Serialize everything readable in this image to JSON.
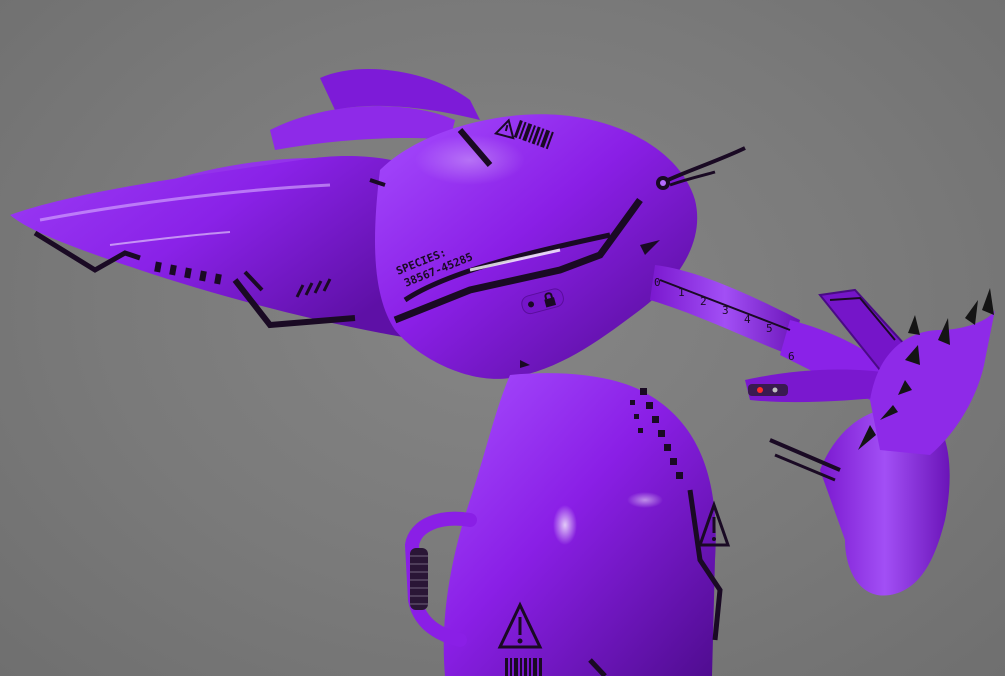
{
  "scene": {
    "subject": "purple latex robotic creature render",
    "background_color": "#7a7a7a",
    "body_color": "#8a1fe6",
    "body_highlight": "#c98cff",
    "body_shadow": "#4a0b86",
    "marking_color": "#1a0a24"
  },
  "decals": {
    "species_label": "SPECIES:",
    "species_id": "38567-45285",
    "ruler_marks": [
      "0",
      "1",
      "2",
      "3",
      "4",
      "5",
      "6"
    ]
  },
  "icons": {
    "warning": "warning-triangle-icon",
    "lock": "lock-icon",
    "barcode": "barcode-icon"
  }
}
